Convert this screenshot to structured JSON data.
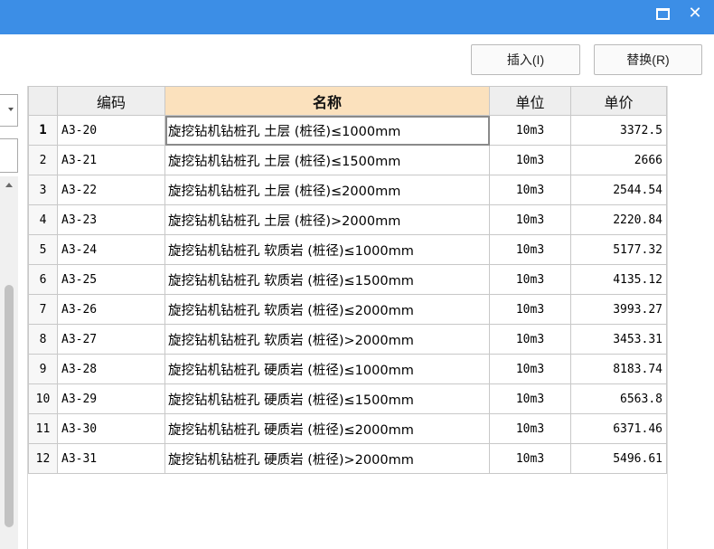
{
  "window": {
    "maximize_icon": "maximize-icon",
    "close_label": "✕"
  },
  "toolbar": {
    "insert_label": "插入(I)",
    "replace_label": "替换(R)"
  },
  "table": {
    "columns": [
      "",
      "编码",
      "名称",
      "单位",
      "单价"
    ],
    "sorted_column": "名称",
    "rows": [
      {
        "n": "1",
        "code": "A3-20",
        "name": "旋挖钻机钻桩孔 土层 (桩径)≤1000mm",
        "unit": "10m3",
        "price": "3372.5"
      },
      {
        "n": "2",
        "code": "A3-21",
        "name": "旋挖钻机钻桩孔 土层 (桩径)≤1500mm",
        "unit": "10m3",
        "price": "2666"
      },
      {
        "n": "3",
        "code": "A3-22",
        "name": "旋挖钻机钻桩孔 土层 (桩径)≤2000mm",
        "unit": "10m3",
        "price": "2544.54"
      },
      {
        "n": "4",
        "code": "A3-23",
        "name": "旋挖钻机钻桩孔 土层 (桩径)>2000mm",
        "unit": "10m3",
        "price": "2220.84"
      },
      {
        "n": "5",
        "code": "A3-24",
        "name": "旋挖钻机钻桩孔 软质岩 (桩径)≤1000mm",
        "unit": "10m3",
        "price": "5177.32"
      },
      {
        "n": "6",
        "code": "A3-25",
        "name": "旋挖钻机钻桩孔 软质岩 (桩径)≤1500mm",
        "unit": "10m3",
        "price": "4135.12"
      },
      {
        "n": "7",
        "code": "A3-26",
        "name": "旋挖钻机钻桩孔 软质岩 (桩径)≤2000mm",
        "unit": "10m3",
        "price": "3993.27"
      },
      {
        "n": "8",
        "code": "A3-27",
        "name": "旋挖钻机钻桩孔 软质岩 (桩径)>2000mm",
        "unit": "10m3",
        "price": "3453.31"
      },
      {
        "n": "9",
        "code": "A3-28",
        "name": "旋挖钻机钻桩孔 硬质岩 (桩径)≤1000mm",
        "unit": "10m3",
        "price": "8183.74"
      },
      {
        "n": "10",
        "code": "A3-29",
        "name": "旋挖钻机钻桩孔 硬质岩 (桩径)≤1500mm",
        "unit": "10m3",
        "price": "6563.8"
      },
      {
        "n": "11",
        "code": "A3-30",
        "name": "旋挖钻机钻桩孔 硬质岩 (桩径)≤2000mm",
        "unit": "10m3",
        "price": "6371.46"
      },
      {
        "n": "12",
        "code": "A3-31",
        "name": "旋挖钻机钻桩孔 硬质岩 (桩径)>2000mm",
        "unit": "10m3",
        "price": "5496.61"
      }
    ]
  },
  "colors": {
    "titlebar": "#3c8ee6",
    "sorted_header": "#fbe1bd"
  }
}
